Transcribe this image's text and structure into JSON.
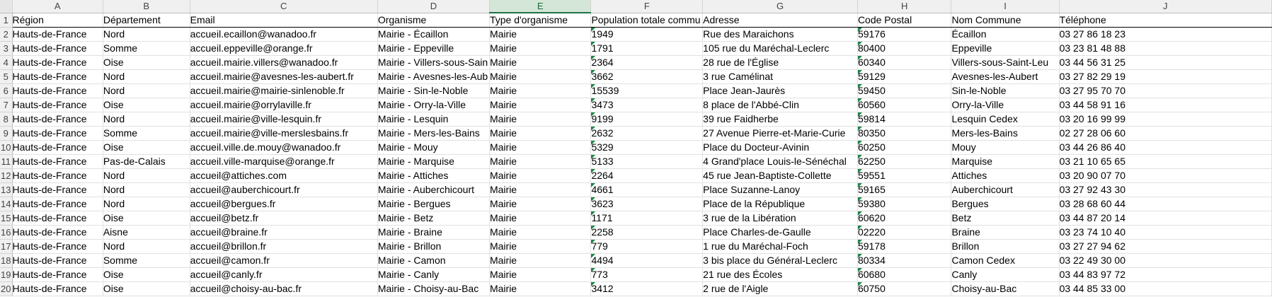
{
  "app": {
    "column_letters": [
      "A",
      "B",
      "C",
      "D",
      "E",
      "F",
      "G",
      "H",
      "I",
      "J"
    ],
    "selected_column": "E",
    "accent_color": "#217346",
    "error_indicator_color": "#1e8449"
  },
  "headers": [
    "Région",
    "Département",
    "Email",
    "Organisme",
    "Type d'organisme",
    "Population totale commu",
    "Adresse",
    "Code Postal",
    "Nom Commune",
    "Téléphone"
  ],
  "rows": [
    {
      "n": "2",
      "c": [
        "Hauts-de-France",
        "Nord",
        "accueil.ecaillon@wanadoo.fr",
        "Mairie - Écaillon",
        "Mairie",
        "1949",
        "Rue des Maraichons",
        "59176",
        "Écaillon",
        "03 27 86 18 23"
      ]
    },
    {
      "n": "3",
      "c": [
        "Hauts-de-France",
        "Somme",
        "accueil.eppeville@orange.fr",
        "Mairie - Eppeville",
        "Mairie",
        "1791",
        "105 rue du Maréchal-Leclerc",
        "80400",
        "Eppeville",
        "03 23 81 48 88"
      ]
    },
    {
      "n": "4",
      "c": [
        "Hauts-de-France",
        "Oise",
        "accueil.mairie.villers@wanadoo.fr",
        "Mairie - Villers-sous-Sain",
        "Mairie",
        "2364",
        "28 rue de l'Église",
        "60340",
        "Villers-sous-Saint-Leu",
        "03 44 56 31 25"
      ]
    },
    {
      "n": "5",
      "c": [
        "Hauts-de-France",
        "Nord",
        "accueil.mairie@avesnes-les-aubert.fr",
        "Mairie - Avesnes-les-Aub",
        "Mairie",
        "3662",
        "3 rue Camélinat",
        "59129",
        "Avesnes-les-Aubert",
        "03 27 82 29 19"
      ]
    },
    {
      "n": "6",
      "c": [
        "Hauts-de-France",
        "Nord",
        "accueil.mairie@mairie-sinlenoble.fr",
        "Mairie - Sin-le-Noble",
        "Mairie",
        "15539",
        "Place Jean-Jaurès",
        "59450",
        "Sin-le-Noble",
        "03 27 95 70 70"
      ]
    },
    {
      "n": "7",
      "c": [
        "Hauts-de-France",
        "Oise",
        "accueil.mairie@orrylaville.fr",
        "Mairie - Orry-la-Ville",
        "Mairie",
        "3473",
        "8 place de l'Abbé-Clin",
        "60560",
        "Orry-la-Ville",
        "03 44 58 91 16"
      ]
    },
    {
      "n": "8",
      "c": [
        "Hauts-de-France",
        "Nord",
        "accueil.mairie@ville-lesquin.fr",
        "Mairie - Lesquin",
        "Mairie",
        "9199",
        "39 rue Faidherbe",
        "59814",
        "Lesquin Cedex",
        "03 20 16 99 99"
      ]
    },
    {
      "n": "9",
      "c": [
        "Hauts-de-France",
        "Somme",
        "accueil.mairie@ville-merslesbains.fr",
        "Mairie - Mers-les-Bains",
        "Mairie",
        "2632",
        "27 Avenue Pierre-et-Marie-Curie",
        "80350",
        "Mers-les-Bains",
        "02 27 28 06 60"
      ]
    },
    {
      "n": "10",
      "c": [
        "Hauts-de-France",
        "Oise",
        "accueil.ville.de.mouy@wanadoo.fr",
        "Mairie - Mouy",
        "Mairie",
        "5329",
        "Place du Docteur-Avinin",
        "60250",
        "Mouy",
        "03 44 26 86 40"
      ]
    },
    {
      "n": "11",
      "c": [
        "Hauts-de-France",
        "Pas-de-Calais",
        "accueil.ville-marquise@orange.fr",
        "Mairie - Marquise",
        "Mairie",
        "5133",
        "4 Grand'place Louis-le-Sénéchal",
        "62250",
        "Marquise",
        "03 21 10 65 65"
      ]
    },
    {
      "n": "12",
      "c": [
        "Hauts-de-France",
        "Nord",
        "accueil@attiches.com",
        "Mairie - Attiches",
        "Mairie",
        "2264",
        "45 rue Jean-Baptiste-Collette",
        "59551",
        "Attiches",
        "03 20 90 07 70"
      ]
    },
    {
      "n": "13",
      "c": [
        "Hauts-de-France",
        "Nord",
        "accueil@auberchicourt.fr",
        "Mairie - Auberchicourt",
        "Mairie",
        "4661",
        "Place Suzanne-Lanoy",
        "59165",
        "Auberchicourt",
        "03 27 92 43 30"
      ]
    },
    {
      "n": "14",
      "c": [
        "Hauts-de-France",
        "Nord",
        "accueil@bergues.fr",
        "Mairie - Bergues",
        "Mairie",
        "3623",
        "Place de la République",
        "59380",
        "Bergues",
        "03 28 68 60 44"
      ]
    },
    {
      "n": "15",
      "c": [
        "Hauts-de-France",
        "Oise",
        "accueil@betz.fr",
        "Mairie - Betz",
        "Mairie",
        "1171",
        "3 rue de la Libération",
        "60620",
        "Betz",
        "03 44 87 20 14"
      ]
    },
    {
      "n": "16",
      "c": [
        "Hauts-de-France",
        "Aisne",
        "accueil@braine.fr",
        "Mairie - Braine",
        "Mairie",
        "2258",
        "Place Charles-de-Gaulle",
        "02220",
        "Braine",
        "03 23 74 10 40"
      ]
    },
    {
      "n": "17",
      "c": [
        "Hauts-de-France",
        "Nord",
        "accueil@brillon.fr",
        "Mairie - Brillon",
        "Mairie",
        "779",
        "1 rue du Maréchal-Foch",
        "59178",
        "Brillon",
        "03 27 27 94 62"
      ]
    },
    {
      "n": "18",
      "c": [
        "Hauts-de-France",
        "Somme",
        "accueil@camon.fr",
        "Mairie - Camon",
        "Mairie",
        "4494",
        "3 bis place du Général-Leclerc",
        "80334",
        "Camon Cedex",
        "03 22 49 30 00"
      ]
    },
    {
      "n": "19",
      "c": [
        "Hauts-de-France",
        "Oise",
        "accueil@canly.fr",
        "Mairie - Canly",
        "Mairie",
        "773",
        "21 rue des Écoles",
        "60680",
        "Canly",
        "03 44 83 97 72"
      ]
    },
    {
      "n": "20",
      "c": [
        "Hauts-de-France",
        "Oise",
        "accueil@choisy-au-bac.fr",
        "Mairie - Choisy-au-Bac",
        "Mairie",
        "3412",
        "2 rue de l'Aigle",
        "60750",
        "Choisy-au-Bac",
        "03 44 85 33 00"
      ]
    }
  ]
}
